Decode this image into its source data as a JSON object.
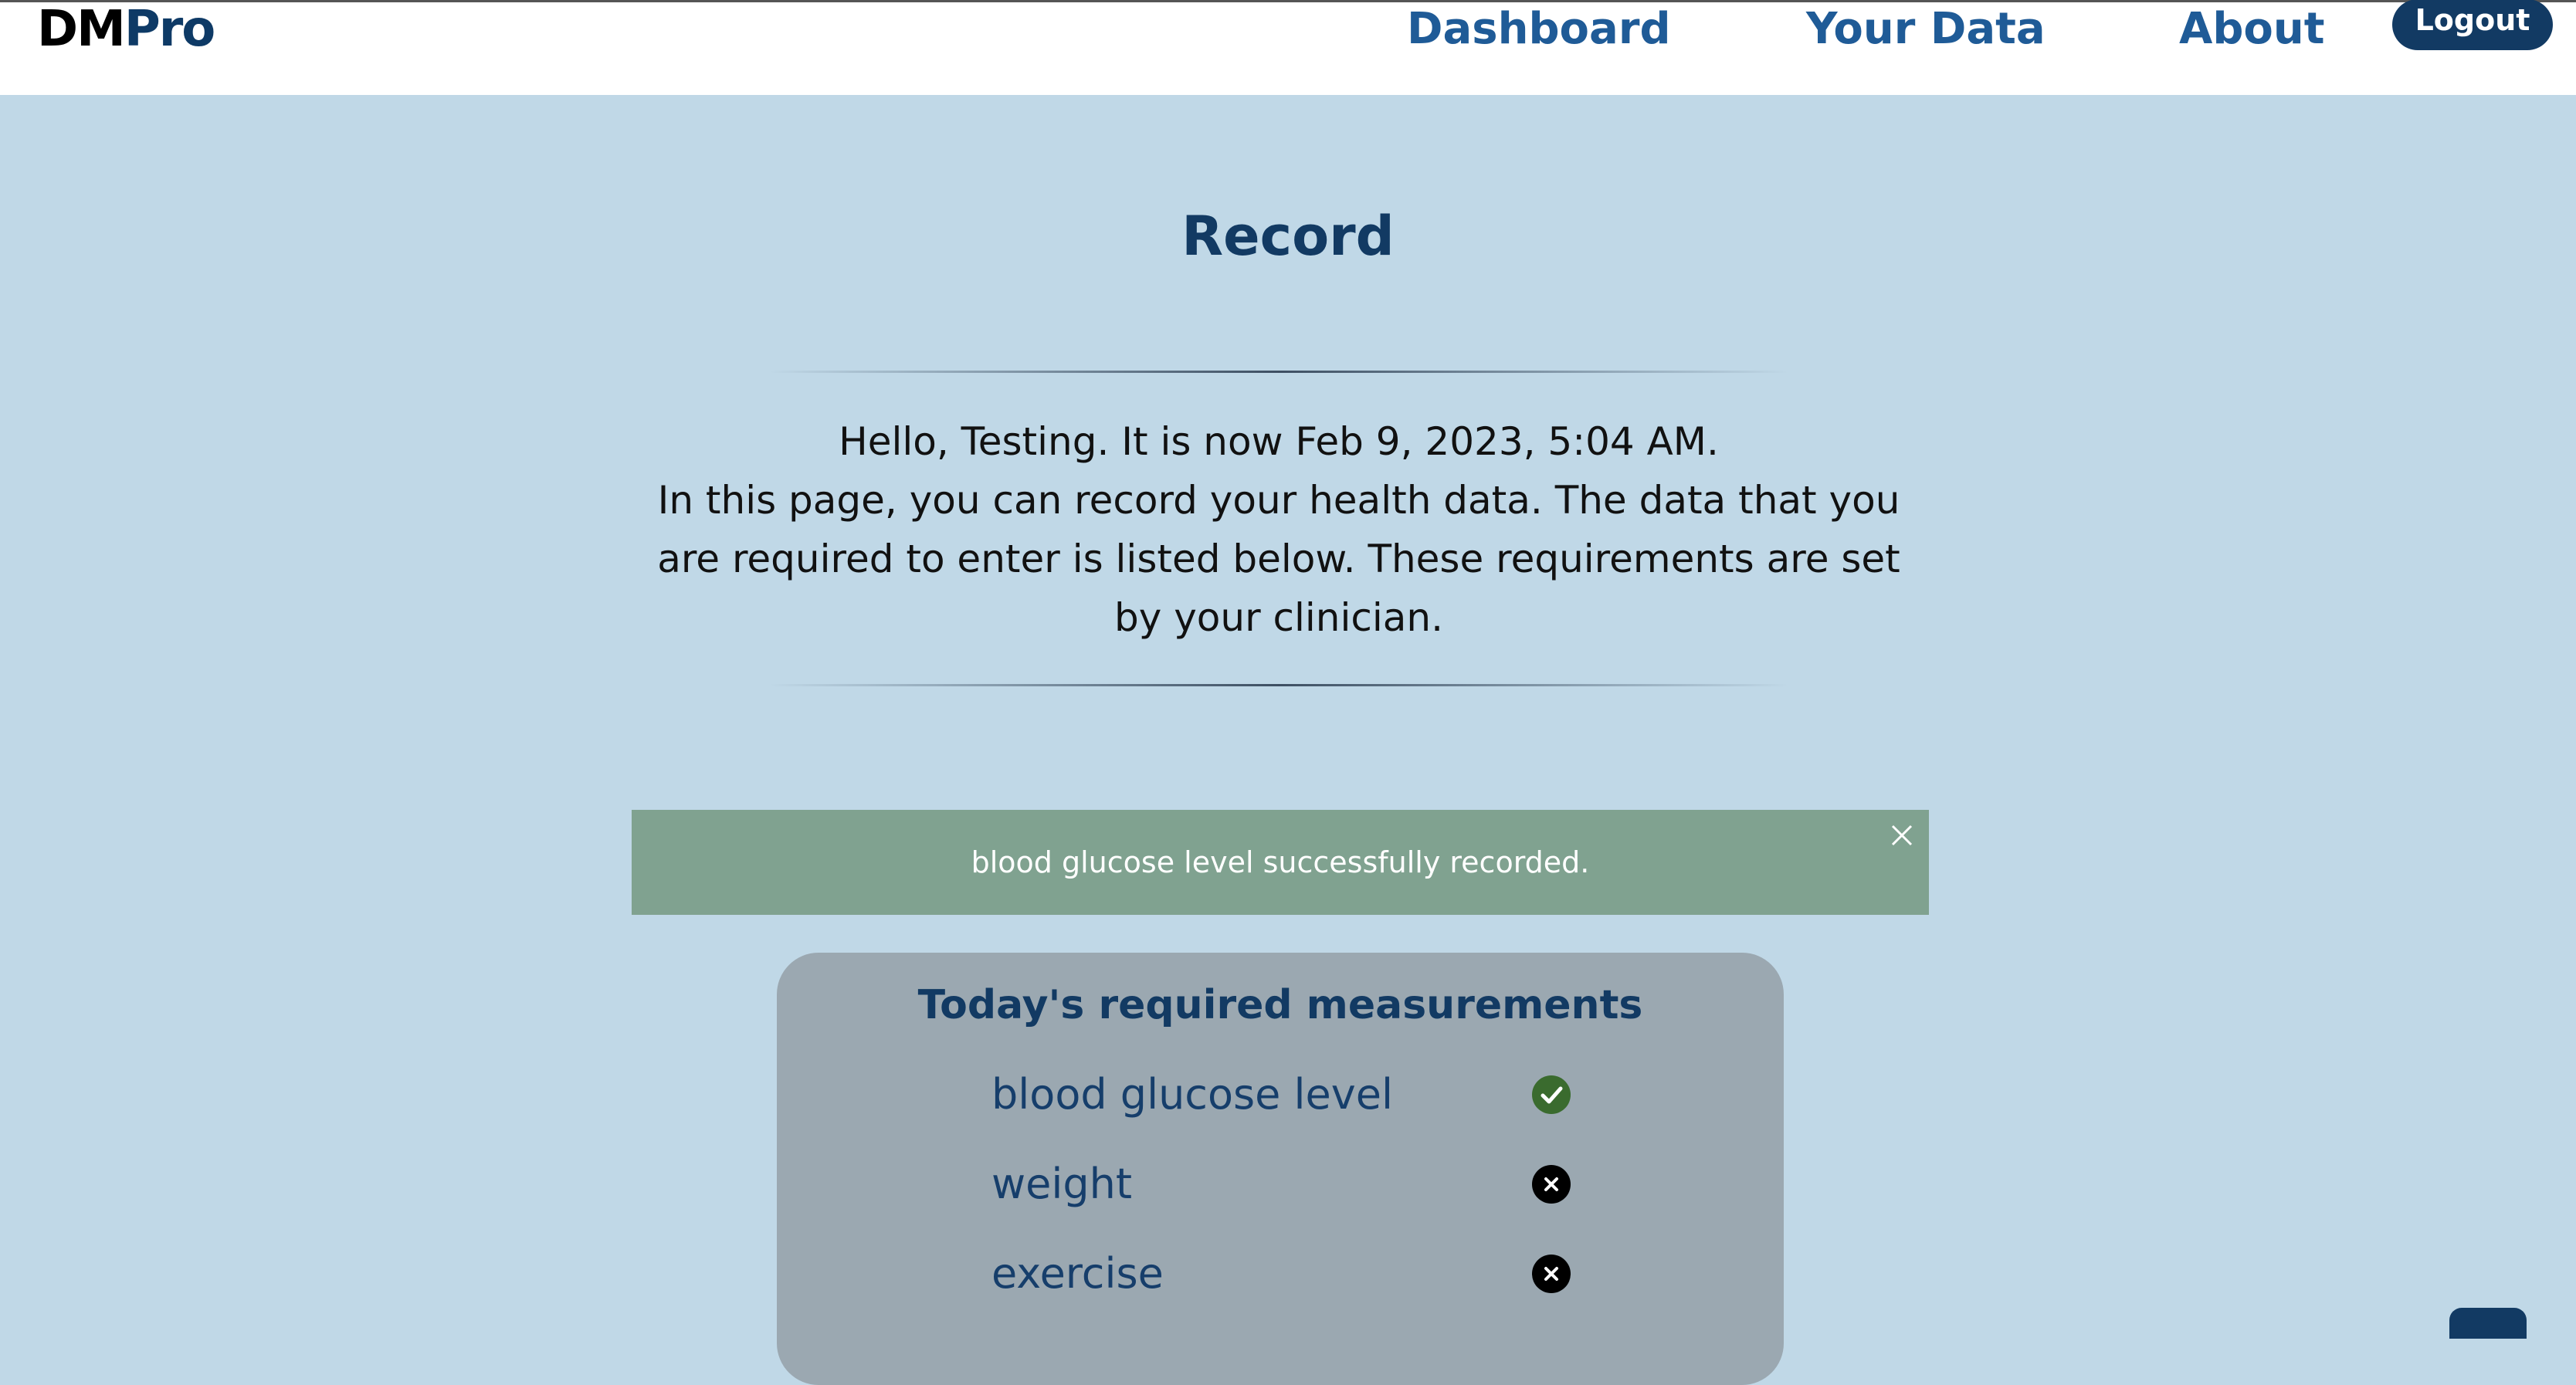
{
  "nav": {
    "brand_part1": "DM",
    "brand_part2": "Pro",
    "links": [
      "Dashboard",
      "Your Data",
      "About"
    ],
    "logout_label": "Logout"
  },
  "page": {
    "title": "Record",
    "greeting": "Hello, Testing. It is now Feb 9, 2023, 5:04 AM.",
    "description": "In this page, you can record your health data. The data that you are required to enter is listed below. These requirements are set by your clinician."
  },
  "alert": {
    "message": "blood glucose level successfully recorded."
  },
  "measurements": {
    "title": "Today's required measurements",
    "items": [
      {
        "label": "blood glucose level",
        "status": "done",
        "icon": "check-circle-icon"
      },
      {
        "label": "weight",
        "status": "pending",
        "icon": "x-circle-icon"
      },
      {
        "label": "exercise",
        "status": "pending",
        "icon": "x-circle-icon"
      }
    ]
  },
  "colors": {
    "background": "#c0d8e7",
    "brand": "#123a63",
    "alert_success": "#80a290",
    "done": "#3a6b2e",
    "pending": "#000000"
  }
}
